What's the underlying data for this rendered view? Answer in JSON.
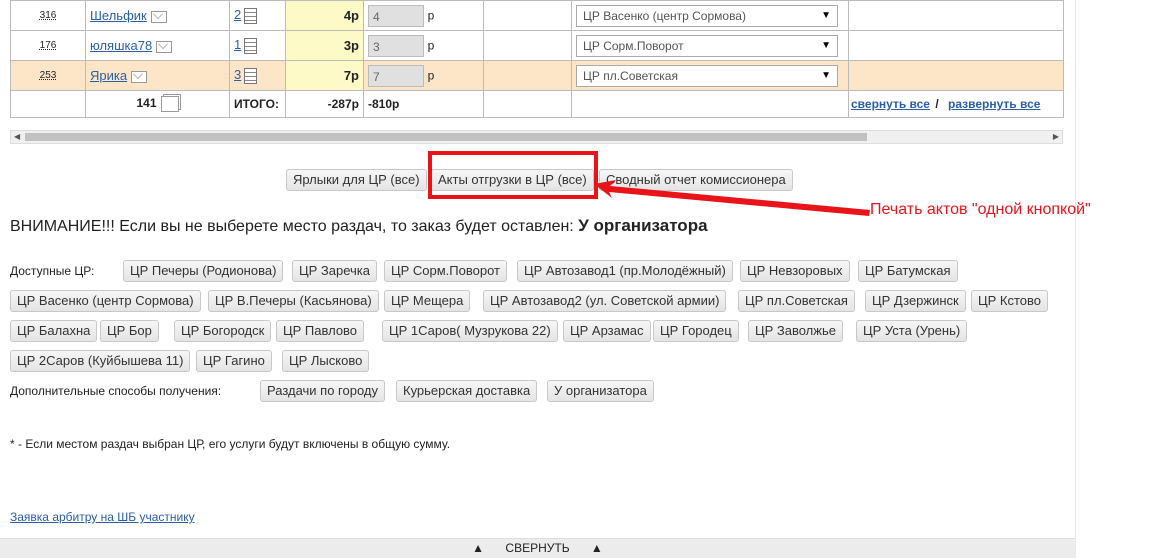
{
  "rows": [
    {
      "num": "316",
      "name": "Шельфик",
      "count": "2",
      "amount": "4р",
      "input": "4",
      "unit": "р",
      "point": "ЦР Васенко (центр Сормова)",
      "hl": false
    },
    {
      "num": "176",
      "name": "юляшка78",
      "count": "1",
      "amount": "3р",
      "input": "3",
      "unit": "р",
      "point": "ЦР Сорм.Поворот",
      "hl": false
    },
    {
      "num": "253",
      "name": "Ярика",
      "count": "3",
      "amount": "7р",
      "input": "7",
      "unit": "р",
      "point": "ЦР пл.Советская",
      "hl": true
    }
  ],
  "totals": {
    "count": "141",
    "label": "ИТОГО:",
    "sum": "-287р",
    "sum2": "-810р",
    "collapse_all": "свернуть все",
    "sep": "/",
    "expand_all": "развернуть все"
  },
  "print_buttons": [
    "Ярлыки для ЦР (все)",
    "Акты отгрузки в ЦР (все)",
    "Сводный отчет комиссионера"
  ],
  "annotation": "Печать актов \"одной кнопкой\"",
  "warning": {
    "text": "ВНИМАНИЕ!!! Если вы не выберете место раздач, то заказ будет оставлен:",
    "target": "У организатора"
  },
  "available_label": "Доступные ЦР:",
  "centers_row1": [
    "ЦР Печеры (Родионова)",
    "ЦР Заречка",
    "ЦР Сорм.Поворот",
    "ЦР Автозавод1 (пр.Молодёжный)",
    "ЦР Невзоровых",
    "ЦР Батумская"
  ],
  "centers_row2": [
    "ЦР Васенко (центр Сормова)",
    "ЦР В.Печеры (Касьянова)",
    "ЦР Мещера",
    "ЦР Автозавод2 (ул. Советской армии)",
    "ЦР пл.Советская",
    "ЦР Дзержинск",
    "ЦР Кстово"
  ],
  "centers_row3": [
    "ЦР Балахна",
    "ЦР Бор",
    "ЦР Богородск",
    "ЦР Павлово",
    "ЦР 1Саров( Музрукова 22)",
    "ЦР Арзамас",
    "ЦР Городец",
    "ЦР Заволжье",
    "ЦР Уста (Урень)"
  ],
  "centers_row4": [
    "ЦР 2Саров (Куйбышева 11)",
    "ЦР Гагино",
    "ЦР Лысково"
  ],
  "extra_label": "Дополнительные способы получения:",
  "extra": [
    "Раздачи по городу",
    "Курьерская доставка",
    "У организатора"
  ],
  "note": "* - Если местом раздач выбран ЦР, его услуги будут включены в общую сумму.",
  "arbiter_link": "Заявка арбитру на ШБ участнику",
  "footer": {
    "arrow": "▲",
    "label": "СВЕРНУТЬ"
  },
  "colors": {
    "accent_red": "#e8141a",
    "link": "#2a5ea8",
    "highlight_row": "#fde5c8",
    "yellow_cell": "#fdfac8"
  }
}
